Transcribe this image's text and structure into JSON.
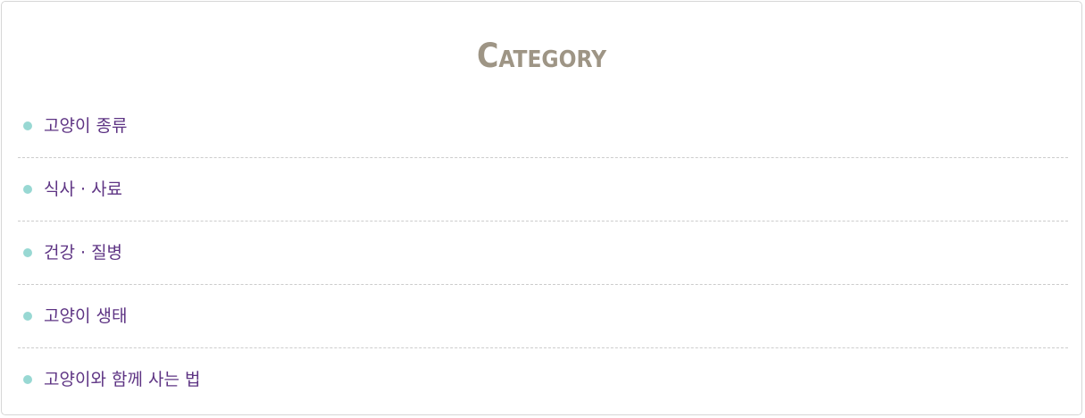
{
  "widget": {
    "title": "Category",
    "items": [
      {
        "label": "고양이 종류"
      },
      {
        "label": "식사 · 사료"
      },
      {
        "label": "건강 · 질병"
      },
      {
        "label": "고양이 생태"
      },
      {
        "label": "고양이와 함께 사는 법"
      }
    ]
  },
  "colors": {
    "title": "#9e9585",
    "bullet": "#98d8d3",
    "label": "#5e3484",
    "divider": "#cccccc",
    "border": "#d6d6d6"
  },
  "icons": {
    "bullet": "bullet-dot-icon"
  }
}
